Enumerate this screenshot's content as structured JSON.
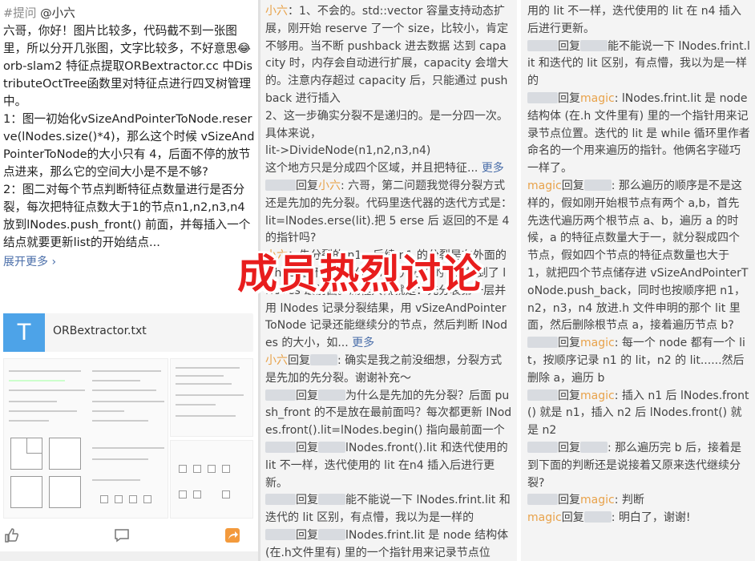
{
  "post": {
    "topic": "#提问",
    "mention": "@小六",
    "body": "六哥，你好！图片比较多，代码截不到一张图里，所以分开几张图，文字比较多，不好意思😂 orb-slam2 特征点提取ORBextractor.cc 中DistributeOctTree函数里对特征点进行四叉树管理中。\n1：图一初始化vSizeAndPointerToNode.reserve(lNodes.size()*4)，那么这个时候 vSizeAndPointerToNode的大小只有 4，后面不停的放节点进来，那么它的空间大小是不是不够?\n2：图二对每个节点判断特征点数量进行是否分裂，每次把特征点数大于1的节点n1,n2,n3,n4放到lNodes.push_front() 前面，并每插入一个结点就要更新list的开始结点...",
    "expand": "展开更多",
    "attachment": {
      "icon_letter": "T",
      "name": "ORBextractor.txt"
    }
  },
  "col2": [
    {
      "author": "小六",
      "text": "：1、不会的。std::vector 容量支持动态扩展，刚开始 reserve 了一个 size，比较小，肯定不够用。当不断 pushback 进去数据 达到 capacity 时，内存会自动进行扩展，capacity 会增大的。注意内存超过 capacity 后，只能通过 pushback 进行插入\n2、这一步确实分裂不是递归的。是一分四一次。具体来说，\nlit->DivideNode(n1,n2,n3,n4)\n这个地方只是分成四个区域，并且把特征...",
      "more": "更多"
    },
    {
      "author": "",
      "reply": "回复",
      "target": "小六",
      "text": ": 六哥，第二问题我觉得分裂方式还是先加的先分裂。代码里迭代器的迭代方式是：lit=lNodes.erse(lit).把 5 erse 后 返回的不是 4 的指针吗?",
      "more": ""
    },
    {
      "author": "小六",
      "text": "：先分裂的 n1。后续 n1 的分裂是在外面的 while 循环里逐步分裂的，先分裂的 n1 加到了 lNodes 最前面。流程大概就是：先分裂第一层并用 lNodes 记录分裂结果，用 vSizeAndPointerToNode 记录还能继续分的节点，然后判断 lNodes 的大小，如...",
      "more": "更多"
    },
    {
      "author": "小六",
      "reply": "回复",
      "target": "",
      "text": ": 确实是我之前没细想，分裂方式是先加的先分裂。谢谢补充～",
      "more": ""
    },
    {
      "author": "",
      "reply": "回复",
      "target": "",
      "text": "为什么是先加的先分裂？后面 push_front 的不是放在最前面吗？每次都更新 lNodes.front().lit=lNodes.begin() 指向最前面一个",
      "more": ""
    },
    {
      "author": "",
      "reply": "回复",
      "target": "",
      "text": "lNodes.front().lit 和迭代使用的 lit 不一样，迭代使用的 lit 在n4 插入后进行更新。",
      "more": ""
    },
    {
      "author": "",
      "reply": "回复",
      "target": "",
      "text": "能不能说一下 lNodes.frint.lit 和迭代的 lit 区别，有点懵，我以为是一样的",
      "more": ""
    },
    {
      "author": "",
      "reply": "回复",
      "target": "",
      "text": "lNodes.frint.lit 是 node 结构体 (在.h文件里有) 里的一个指针用来记录节点位",
      "more": ""
    }
  ],
  "col3": [
    {
      "author": "",
      "reply": "",
      "target": "",
      "text": "用的 lit 不一样，迭代使用的 lit 在 n4 插入后进行更新。"
    },
    {
      "author": "",
      "reply": "回复",
      "target": "",
      "text": "能不能说一下 lNodes.frint.lit 和迭代的 lit 区别，有点懵，我以为是一样的"
    },
    {
      "author": "",
      "reply": "回复",
      "target": "magic",
      "text": ": lNodes.frint.lit 是 node 结构体 (在.h 文件里有) 里的一个指针用来记录节点位置。迭代的 lit 是 while 循环里作者命名的一个用来遍历的指针。他俩名字碰巧一样了。"
    },
    {
      "author": "magic",
      "reply": "回复",
      "target": "",
      "text": ": 那么遍历的顺序是不是这样的，假如刚开始根节点有两个 a,b，首先先迭代遍历两个根节点 a、b，遍历 a 的时候，a 的特征点数量大于一，就分裂成四个节点，假如四个节点的特征点数量也大于 1，就把四个节点储存进 vSizeAndPointerToNode.push_back，同时也按顺序把 n1，n2，n3，n4 放进.h 文件申明的那个 lit 里面，然后删除根节点 a，接着遍历节点 b?"
    },
    {
      "author": "",
      "reply": "回复",
      "target": "magic",
      "text": ": 每一个 node 都有一个 lit，按顺序记录 n1 的 lit，n2 的 lit......然后删除 a，遍历 b"
    },
    {
      "author": "",
      "reply": "回复",
      "target": "magic",
      "text": ": 插入 n1 后 lNodes.front() 就是 n1，插入 n2 后 lNodes.front() 就是 n2"
    },
    {
      "author": "",
      "reply": "回复",
      "target": "",
      "text": ": 那么遍历完 b 后，接着是到下面的判断还是说接着又原来迭代继续分裂?"
    },
    {
      "author": "",
      "reply": "回复",
      "target": "magic",
      "text": ": 判断"
    },
    {
      "author": "magic",
      "reply": "回复",
      "target": "",
      "text": ": 明白了，谢谢!"
    }
  ],
  "overlay": {
    "text": "成员热烈讨论",
    "color": "#e81d1d"
  },
  "colors": {
    "link": "#4a6ea9",
    "author": "#e8a24a",
    "file_icon": "#4da3e8"
  }
}
